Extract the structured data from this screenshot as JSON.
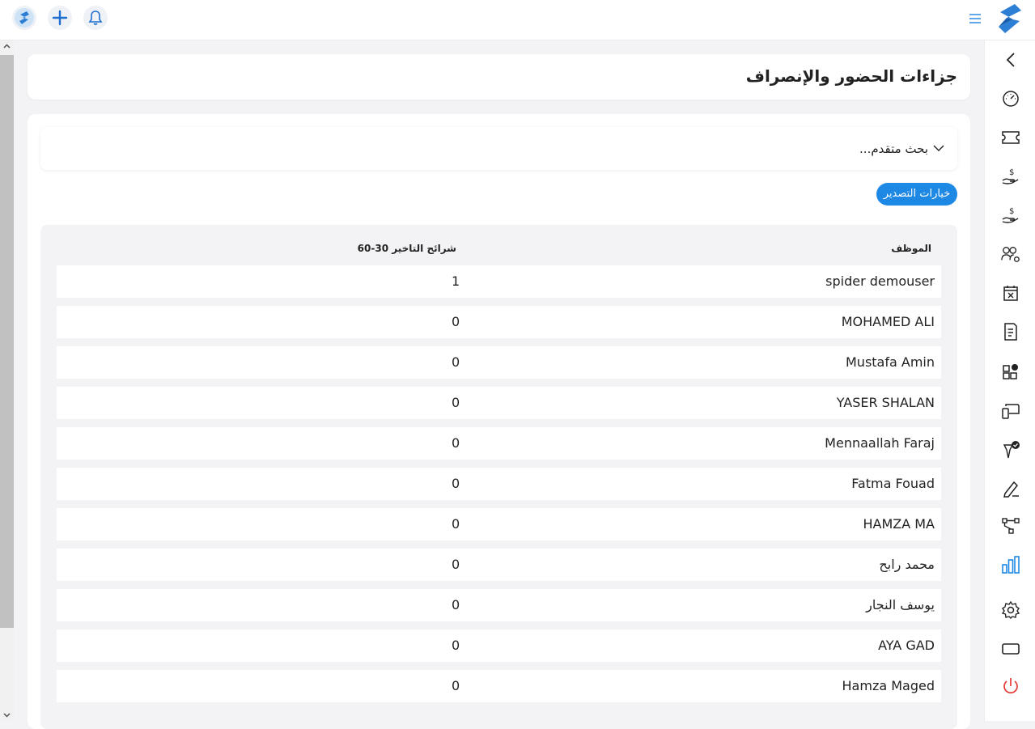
{
  "topbar": {
    "logo": "app-logo",
    "add_icon": "plus-icon",
    "notifications_icon": "bell-icon",
    "menu_icon": "hamburger-icon"
  },
  "page": {
    "title": "جزاءات الحضور والإنصراف"
  },
  "filters": {
    "advanced_search_label": "بحث متقدم...",
    "export_button_label": "خيارات التصدير"
  },
  "table": {
    "columns": [
      "الموظف",
      "شرائح التاخير 30-60"
    ],
    "rows": [
      {
        "employee": "spider demouser",
        "value": "1"
      },
      {
        "employee": "MOHAMED ALI",
        "value": "0"
      },
      {
        "employee": "Mustafa Amin",
        "value": "0"
      },
      {
        "employee": "YASER SHALAN",
        "value": "0"
      },
      {
        "employee": "Mennaallah Faraj",
        "value": "0"
      },
      {
        "employee": "Fatma Fouad",
        "value": "0"
      },
      {
        "employee": "HAMZA MA",
        "value": "0"
      },
      {
        "employee": "محمد رابح",
        "value": "0"
      },
      {
        "employee": "يوسف النجار",
        "value": "0"
      },
      {
        "employee": "AYA GAD",
        "value": "0"
      },
      {
        "employee": "Hamza Maged",
        "value": "0"
      }
    ]
  },
  "sidebar": {
    "items": [
      "collapse-chevron-icon",
      "dashboard-gauge-icon",
      "ticket-icon",
      "salary-hand-icon",
      "payment-hand-icon",
      "users-settings-icon",
      "calendar-cancel-icon",
      "document-list-icon",
      "apps-grid-icon",
      "devices-icon",
      "approval-badge-icon",
      "signature-pen-icon",
      "workflow-icon",
      "reports-chart-icon",
      "settings-gear-icon",
      "screen-icon",
      "power-icon"
    ],
    "active": "reports-chart-icon"
  },
  "colors": {
    "accent": "#1e88e5",
    "danger": "#e53935",
    "background": "#f3f3f5"
  }
}
